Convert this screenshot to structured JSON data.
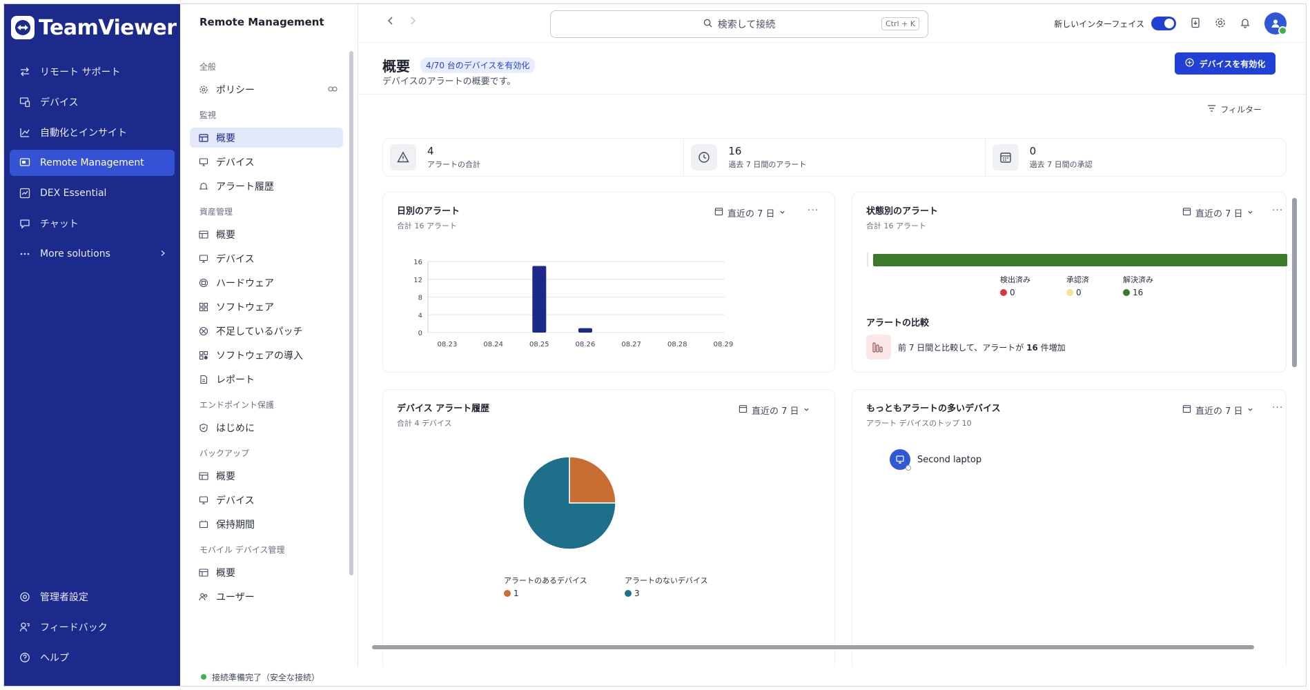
{
  "app": {
    "logo_text": "TeamViewer",
    "subnav_title": "Remote Management",
    "colors": {
      "nav_bg": "#1c2a8c",
      "accent": "#2140d6",
      "bar_blue": "#1b2a8a",
      "status_green": "#3b7a2a",
      "pie_orange": "#c96e32",
      "pie_teal": "#1e6f8a",
      "detected_red": "#d63a3a",
      "ack_yellow": "#f2e58a"
    }
  },
  "leftnav": {
    "items": [
      {
        "label": "リモート サポート",
        "icon": "arrows-swap-icon"
      },
      {
        "label": "デバイス",
        "icon": "devices-icon"
      },
      {
        "label": "自動化とインサイト",
        "icon": "automation-icon"
      },
      {
        "label": "Remote Management",
        "icon": "remote-management-icon"
      },
      {
        "label": "DEX Essential",
        "icon": "dex-icon"
      },
      {
        "label": "チャット",
        "icon": "chat-icon"
      },
      {
        "label": "More solutions",
        "icon": "more-icon"
      }
    ],
    "bottom": [
      {
        "label": "管理者設定",
        "icon": "admin-settings-icon"
      },
      {
        "label": "フィードバック",
        "icon": "feedback-icon"
      },
      {
        "label": "ヘルプ",
        "icon": "help-icon"
      }
    ]
  },
  "subnav": {
    "sections": [
      {
        "title": "全般",
        "items": [
          "ポリシー"
        ]
      },
      {
        "title": "監視",
        "items": [
          "概要",
          "デバイス",
          "アラート履歴"
        ]
      },
      {
        "title": "資産管理",
        "items": [
          "概要",
          "デバイス",
          "ハードウェア",
          "ソフトウェア",
          "不足しているパッチ",
          "ソフトウェアの導入",
          "レポート"
        ]
      },
      {
        "title": "エンドポイント保護",
        "items": [
          "はじめに"
        ]
      },
      {
        "title": "バックアップ",
        "items": [
          "概要",
          "デバイス",
          "保持期間"
        ]
      },
      {
        "title": "モバイル デバイス管理",
        "items": [
          "概要",
          "ユーザー"
        ]
      }
    ],
    "status_text": "接続準備完了（安全な接続）"
  },
  "topbar": {
    "search_placeholder": "検索して接続",
    "search_shortcut": "Ctrl + K",
    "new_interface_label": "新しいインターフェイス"
  },
  "main": {
    "title": "概要",
    "badge": "4/70 台のデバイスを有効化",
    "subtitle": "デバイスのアラートの概要です。",
    "activate_button": "デバイスを有効化",
    "filter_label": "フィルター",
    "stats": [
      {
        "value": "4",
        "label": "アラートの合計"
      },
      {
        "value": "16",
        "label": "過去 7 日間のアラート"
      },
      {
        "value": "0",
        "label": "過去 7 日間の承認"
      }
    ],
    "range_label": "直近の 7 日",
    "daily": {
      "title": "日別のアラート",
      "sub": "合計 16 アラート"
    },
    "status": {
      "title": "状態別のアラート",
      "sub": "合計 16 アラート",
      "legend": [
        {
          "label": "検出済み",
          "value": "0"
        },
        {
          "label": "承認済",
          "value": "0"
        },
        {
          "label": "解決済み",
          "value": "16"
        }
      ],
      "compare_title": "アラートの比較",
      "compare_text_pre": "前 7 日間と比較して、アラートが ",
      "compare_value": "16",
      "compare_text_post": " 件増加"
    },
    "history": {
      "title": "デバイス アラート履歴",
      "sub": "合計 4 デバイス",
      "legend": [
        {
          "label": "アラートのあるデバイス",
          "value": "1"
        },
        {
          "label": "アラートのないデバイス",
          "value": "3"
        }
      ]
    },
    "topdev": {
      "title": "もっともアラートの多いデバイス",
      "sub": "アラート デバイスのトップ 10",
      "device_name": "Second laptop"
    }
  },
  "chart_data": [
    {
      "type": "bar",
      "title": "日別のアラート",
      "categories": [
        "08.23",
        "08.24",
        "08.25",
        "08.26",
        "08.27",
        "08.28",
        "08.29"
      ],
      "values": [
        0,
        0,
        15,
        1,
        0,
        0,
        0
      ],
      "yticks": [
        0,
        4,
        8,
        12,
        16
      ],
      "ylim": [
        0,
        16
      ],
      "grid": true
    },
    {
      "type": "bar",
      "title": "状態別のアラート",
      "categories": [
        "検出済み",
        "承認済",
        "解決済み"
      ],
      "values": [
        0,
        0,
        16
      ],
      "orientation": "horizontal-stacked"
    },
    {
      "type": "pie",
      "title": "デバイス アラート履歴",
      "categories": [
        "アラートのあるデバイス",
        "アラートのないデバイス"
      ],
      "values": [
        1,
        3
      ]
    }
  ]
}
